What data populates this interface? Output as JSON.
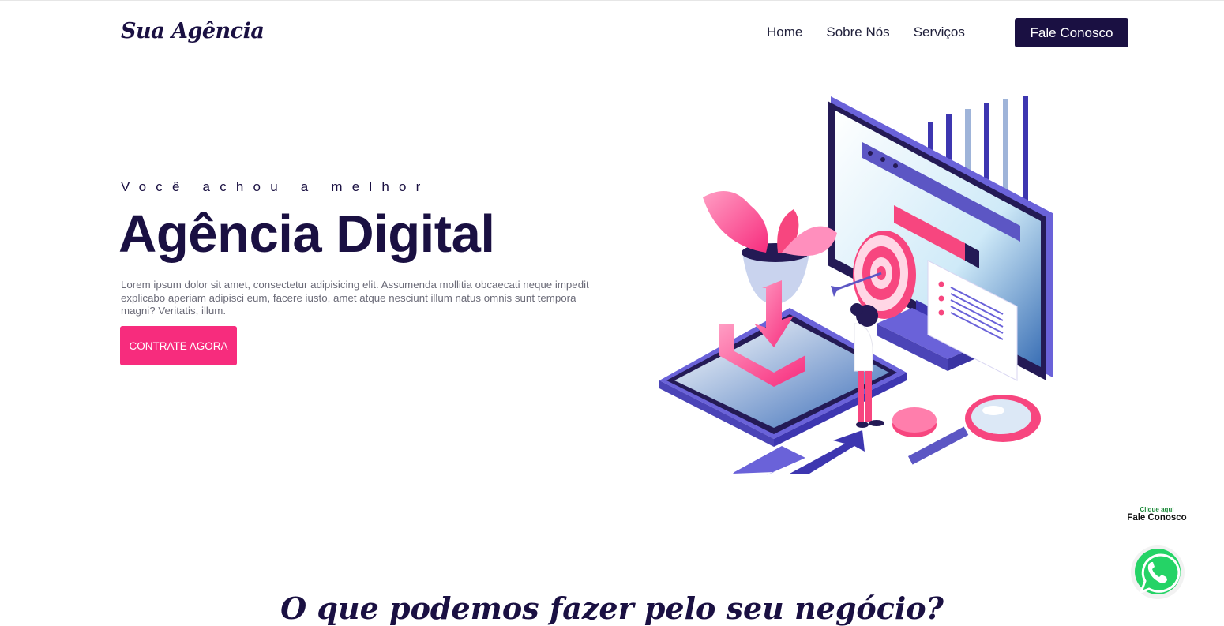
{
  "nav": {
    "logo": "Sua Agência",
    "links": [
      "Home",
      "Sobre Nós",
      "Serviços"
    ],
    "cta": "Fale Conosco"
  },
  "hero": {
    "eyebrow": "Você achou a melhor",
    "title": "Agência Digital",
    "description": "Lorem ipsum dolor sit amet, consectetur adipisicing elit. Assumenda mollitia obcaecati neque impedit explicabo aperiam adipisci eum, facere iusto, amet atque nesciunt illum natus omnis sunt tempora magni? Veritatis, illum.",
    "cta": "CONTRATE AGORA"
  },
  "float_widget": {
    "hint_small": "Clique aqui",
    "hint_big": "Fale Conosco",
    "icon": "whatsapp-icon"
  },
  "section": {
    "title": "O que podemos fazer pelo seu negócio?"
  },
  "colors": {
    "navy": "#1a1042",
    "pink": "#f72c7d",
    "purple": "#5b55c9",
    "whatsapp_green": "#25d366"
  }
}
